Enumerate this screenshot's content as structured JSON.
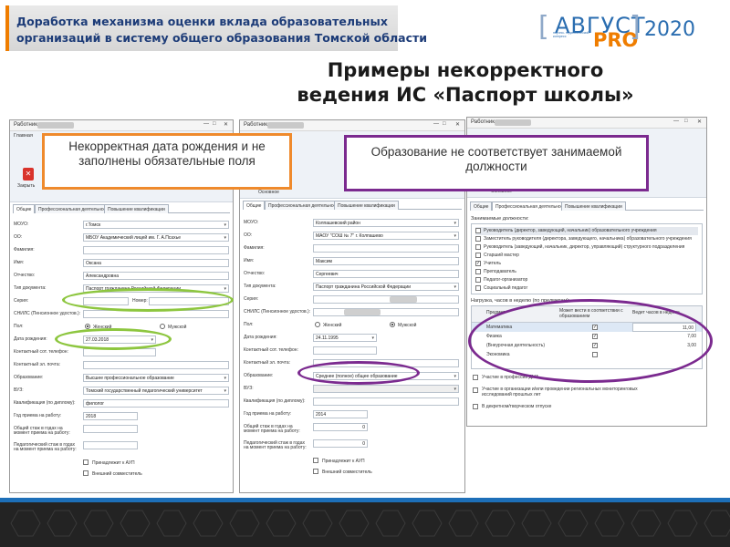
{
  "header": {
    "line1": "Доработка механизма оценки вклада образовательных",
    "line2": "организаций в систему общего образования Томской области"
  },
  "logo": {
    "brand": "АВГУСТ",
    "brand_suffix": "PRO",
    "year": "2020",
    "tagline": "научно- педагогический конгресс"
  },
  "title": {
    "line1": "Примеры некорректного",
    "line2": "ведения ИС «Паспорт школы»"
  },
  "callouts": {
    "left": "Некорректная дата рождения и не заполнены обязательные поля",
    "right": "Образование не соответствует занимаемой должности"
  },
  "accent_colors": {
    "orange": "#ef8a2c",
    "purple": "#7b2a8f",
    "green": "#8dc63f",
    "navy": "#1d3c78"
  },
  "window_common": {
    "title": "Работник",
    "ribbon_tab": "Главная",
    "close_label": "Закрыть",
    "group_label": "Основное",
    "tabs": [
      "Общие",
      "Профессиональная деятельность",
      "Повышение квалификации"
    ]
  },
  "window1": {
    "rows": [
      {
        "label": "МОУО:",
        "value": "г.Томск"
      },
      {
        "label": "ОО:",
        "value": "МБОУ Академический лицей им. Г. А.Псахье"
      },
      {
        "label": "Фамилия:",
        "value": ""
      },
      {
        "label": "Имя:",
        "value": "Оксана"
      },
      {
        "label": "Отчество:",
        "value": "Александровна"
      },
      {
        "label": "Тип документа:",
        "value": "Паспорт гражданина Российской Федерации"
      }
    ],
    "series_label": "Серия:",
    "number_label": "Номер:",
    "snils_label": "СНИЛС (Пенсионное удостов.):",
    "sex_label": "Пол:",
    "female": "Женский",
    "male": "Мужской",
    "birth_label": "Дата рождения:",
    "birth_value": "27.03.2018",
    "phone_label": "Контактный сот. телефон:",
    "email_label": "Контактный эл. почта:",
    "education_label": "Образование:",
    "education_value": "Высшее профессиональное образование",
    "vuz_label": "ВУЗ:",
    "vuz_value": "Томский государственный педагогический университет",
    "qual_label": "Квалификация (по диплому):",
    "qual_value": "филолог",
    "year_label": "Год приема на работу:",
    "year_value": "2018",
    "total_exp_label": "Общий стаж в годах на момент приема на работу:",
    "ped_exp_label": "Педагогический стаж в годах на момент приема на работу:",
    "aup_label": "Принадлежит к АУП",
    "ext_label": "Внешний совместитель"
  },
  "window2": {
    "rows": [
      {
        "label": "МОУО:",
        "value": "Колпашевский район"
      },
      {
        "label": "ОО:",
        "value": "МАОУ \"СОШ № 7\" г. Колпашево"
      },
      {
        "label": "Фамилия:",
        "value": ""
      },
      {
        "label": "Имя:",
        "value": "Максим"
      },
      {
        "label": "Отчество:",
        "value": "Сергеевич"
      },
      {
        "label": "Тип документа:",
        "value": "Паспорт гражданина Российской Федерации"
      }
    ],
    "series_label": "Серия:",
    "snils_label": "СНИЛС (Пенсионное удостов.):",
    "sex_label": "Пол:",
    "female": "Женский",
    "male": "Мужской",
    "birth_label": "Дата рождения:",
    "birth_value": "24.11.1995",
    "phone_label": "Контактный сот. телефон:",
    "email_label": "Контактный эл. почта:",
    "education_label": "Образование:",
    "education_value": "Среднее (полное) общее образование",
    "vuz_label": "ВУЗ:",
    "qual_label": "Квалификация (по диплому):",
    "year_label": "Год приема на работу:",
    "year_value": "2014",
    "total_exp_label": "Общий стаж в годах на момент приема на работу:",
    "total_exp_value": "0",
    "ped_exp_label": "Педагогический стаж в годах на момент приема на работу:",
    "ped_exp_value": "0",
    "aup_label": "Принадлежит к АУП",
    "ext_label": "Внешний совместитель"
  },
  "window3": {
    "positions_label": "Занимаемые должности:",
    "positions": [
      {
        "label": "Руководитель (директор, заведующий, начальник) образовательного учреждения",
        "checked": false
      },
      {
        "label": "Заместитель руководителя (директора, заведующего, начальника) образовательного учреждения",
        "checked": false
      },
      {
        "label": "Руководитель (заведующий, начальник, директор, управляющий) структурного подразделения",
        "checked": false
      },
      {
        "label": "Старший мастер",
        "checked": false
      },
      {
        "label": "Учитель",
        "checked": true
      },
      {
        "label": "Преподаватель",
        "checked": false
      },
      {
        "label": "Педагог-организатор",
        "checked": false
      },
      {
        "label": "Социальный педагог",
        "checked": false
      }
    ],
    "load_label": "Нагрузка, часов в неделю (по предметам):",
    "col_subject": "Предмет",
    "col_match": "Может вести в соответствии с образованием",
    "col_hours": "Ведет часов в неделю",
    "subjects": [
      {
        "name": "Математика",
        "match": true,
        "hours": "11,00"
      },
      {
        "name": "Физика",
        "match": true,
        "hours": "7,00"
      },
      {
        "name": "(Внеурочная деятельность)",
        "match": true,
        "hours": "3,00"
      },
      {
        "name": "Экономика",
        "match": false,
        "hours": ""
      }
    ],
    "extra1": "Участие в профессии ДМА",
    "extra2": "Участие в организации и/или проведении региональных мониторинговых исследований прошлых лет",
    "extra3": "В декретном/творческом отпуске"
  }
}
